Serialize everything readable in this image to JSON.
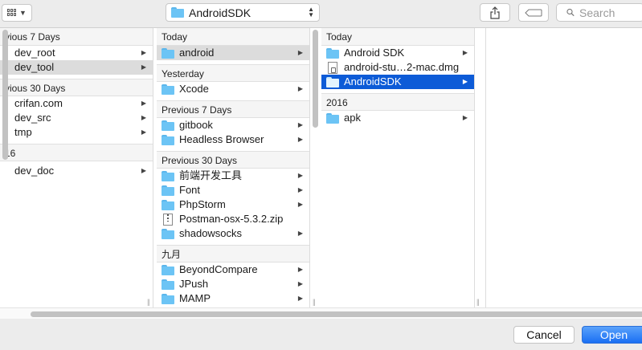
{
  "toolbar": {
    "view_mode_icon": "column-view-icon",
    "location": "AndroidSDK",
    "search_placeholder": "Search"
  },
  "columns": [
    {
      "sections": [
        {
          "header": "vious 7 Days",
          "items": [
            {
              "name": "dev_root",
              "kind": "folder",
              "has_children": true,
              "state": "none"
            },
            {
              "name": "dev_tool",
              "kind": "folder",
              "has_children": true,
              "state": "gray"
            }
          ]
        },
        {
          "header": "vious 30 Days",
          "items": [
            {
              "name": "crifan.com",
              "kind": "folder",
              "has_children": true,
              "state": "none"
            },
            {
              "name": "dev_src",
              "kind": "folder",
              "has_children": true,
              "state": "none"
            },
            {
              "name": "tmp",
              "kind": "folder",
              "has_children": true,
              "state": "none"
            }
          ]
        },
        {
          "header": "16",
          "items": [
            {
              "name": "dev_doc",
              "kind": "folder",
              "has_children": true,
              "state": "none"
            }
          ]
        }
      ]
    },
    {
      "sections": [
        {
          "header": "Today",
          "items": [
            {
              "name": "android",
              "kind": "folder",
              "has_children": true,
              "state": "gray"
            }
          ]
        },
        {
          "header": "Yesterday",
          "items": [
            {
              "name": "Xcode",
              "kind": "folder",
              "has_children": true,
              "state": "none"
            }
          ]
        },
        {
          "header": "Previous 7 Days",
          "items": [
            {
              "name": "gitbook",
              "kind": "folder",
              "has_children": true,
              "state": "none"
            },
            {
              "name": "Headless Browser",
              "kind": "folder",
              "has_children": true,
              "state": "none"
            }
          ]
        },
        {
          "header": "Previous 30 Days",
          "items": [
            {
              "name": "前端开发工具",
              "kind": "folder",
              "has_children": true,
              "state": "none"
            },
            {
              "name": "Font",
              "kind": "folder",
              "has_children": true,
              "state": "none"
            },
            {
              "name": "PhpStorm",
              "kind": "folder",
              "has_children": true,
              "state": "none"
            },
            {
              "name": "Postman-osx-5.3.2.zip",
              "kind": "zip",
              "has_children": false,
              "state": "none"
            },
            {
              "name": "shadowsocks",
              "kind": "folder",
              "has_children": true,
              "state": "none"
            }
          ]
        },
        {
          "header": "九月",
          "items": [
            {
              "name": "BeyondCompare",
              "kind": "folder",
              "has_children": true,
              "state": "none"
            },
            {
              "name": "JPush",
              "kind": "folder",
              "has_children": true,
              "state": "none"
            },
            {
              "name": "MAMP",
              "kind": "folder",
              "has_children": true,
              "state": "none"
            }
          ]
        }
      ]
    },
    {
      "sections": [
        {
          "header": "Today",
          "items": [
            {
              "name": "Android SDK",
              "kind": "folder",
              "has_children": true,
              "state": "none"
            },
            {
              "name": "android-stu…2-mac.dmg",
              "kind": "file",
              "has_children": false,
              "state": "none"
            },
            {
              "name": "AndroidSDK",
              "kind": "folder",
              "has_children": true,
              "state": "blue"
            }
          ]
        },
        {
          "header": "2016",
          "items": [
            {
              "name": "apk",
              "kind": "folder",
              "has_children": true,
              "state": "none"
            }
          ]
        }
      ]
    },
    {
      "sections": []
    }
  ],
  "footer": {
    "cancel_label": "Cancel",
    "open_label": "Open"
  },
  "colors": {
    "selection_blue": "#0d5bd7",
    "selection_gray": "#dcdcdc",
    "folder_blue": "#6cc4f5"
  }
}
